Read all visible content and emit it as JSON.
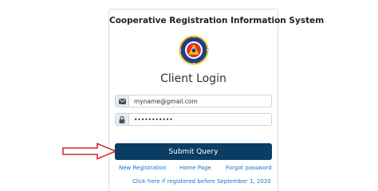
{
  "header": {
    "system_title": "Cooperative Registration Information System"
  },
  "login": {
    "title": "Client Login",
    "email_value": "myname@gmail.com",
    "password_value": "•••••••••••",
    "submit_label": "Submit Query"
  },
  "links": {
    "new_registration": "New Registration",
    "home_page": "Home Page",
    "forgot_password": "Forgot password",
    "registered_before": "Click here if registered before September 1, 2020"
  },
  "icons": {
    "email": "envelope-icon",
    "password": "lock-icon",
    "annotation": "arrow-right-icon",
    "logo": "agency-seal"
  },
  "colors": {
    "submit_bg": "#0b3c64",
    "link": "#1a73c8",
    "arrow": "#d9262c"
  }
}
